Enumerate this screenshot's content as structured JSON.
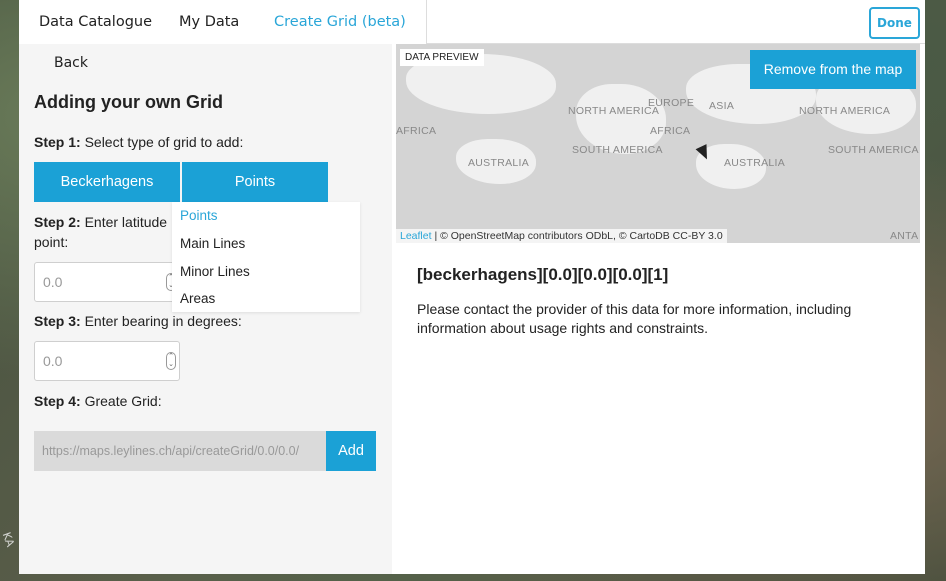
{
  "tabs": [
    {
      "label": "Data Catalogue"
    },
    {
      "label": "My Data"
    },
    {
      "label": "Create Grid (beta)"
    }
  ],
  "done_label": "Done",
  "left": {
    "back_label": "Back",
    "heading": "Adding your own Grid",
    "step1": {
      "label": "Step 1:",
      "text": " Select type of grid to add:"
    },
    "grid_buttons": [
      "Beckerhagens",
      "Points"
    ],
    "step2": {
      "label": "Step 2:",
      "text": " Enter latitude",
      "text2": "point:"
    },
    "latitude": {
      "value": "0.0"
    },
    "step3": {
      "label": "Step 3:",
      "text": " Enter bearing in degrees:"
    },
    "bearing": {
      "value": "0.0"
    },
    "step4": {
      "label": "Step 4:",
      "text": " Greate Grid:"
    },
    "url_value": "https://maps.leylines.ch/api/createGrid/0.0/0.0/",
    "add_label": "Add",
    "dropdown": {
      "options": [
        "Points",
        "Main Lines",
        "Minor Lines",
        "Areas"
      ],
      "selected": "Points"
    }
  },
  "right": {
    "preview_tag": "DATA PREVIEW",
    "remove_label": "Remove from the map",
    "map_labels": [
      "NORTH AMERICA",
      "EUROPE",
      "ASIA",
      "NORTH AMERICA",
      "AFRICA",
      "AFRICA",
      "SOUTH AMERICA",
      "AUSTRALIA",
      "AUSTRALIA",
      "SOUTH AMERICA",
      "ANTA"
    ],
    "attribution_leaflet": "Leaflet",
    "attribution_text": " | © OpenStreetMap contributors ODbL, © CartoDB CC-BY 3.0",
    "data_title": "[beckerhagens][0.0][0.0][0.0][1]",
    "data_desc": "Please contact the provider of this data for more information, including information about usage rights and constraints."
  },
  "colors": {
    "accent": "#1ba1d6",
    "accent_text": "#2aa6d8"
  }
}
